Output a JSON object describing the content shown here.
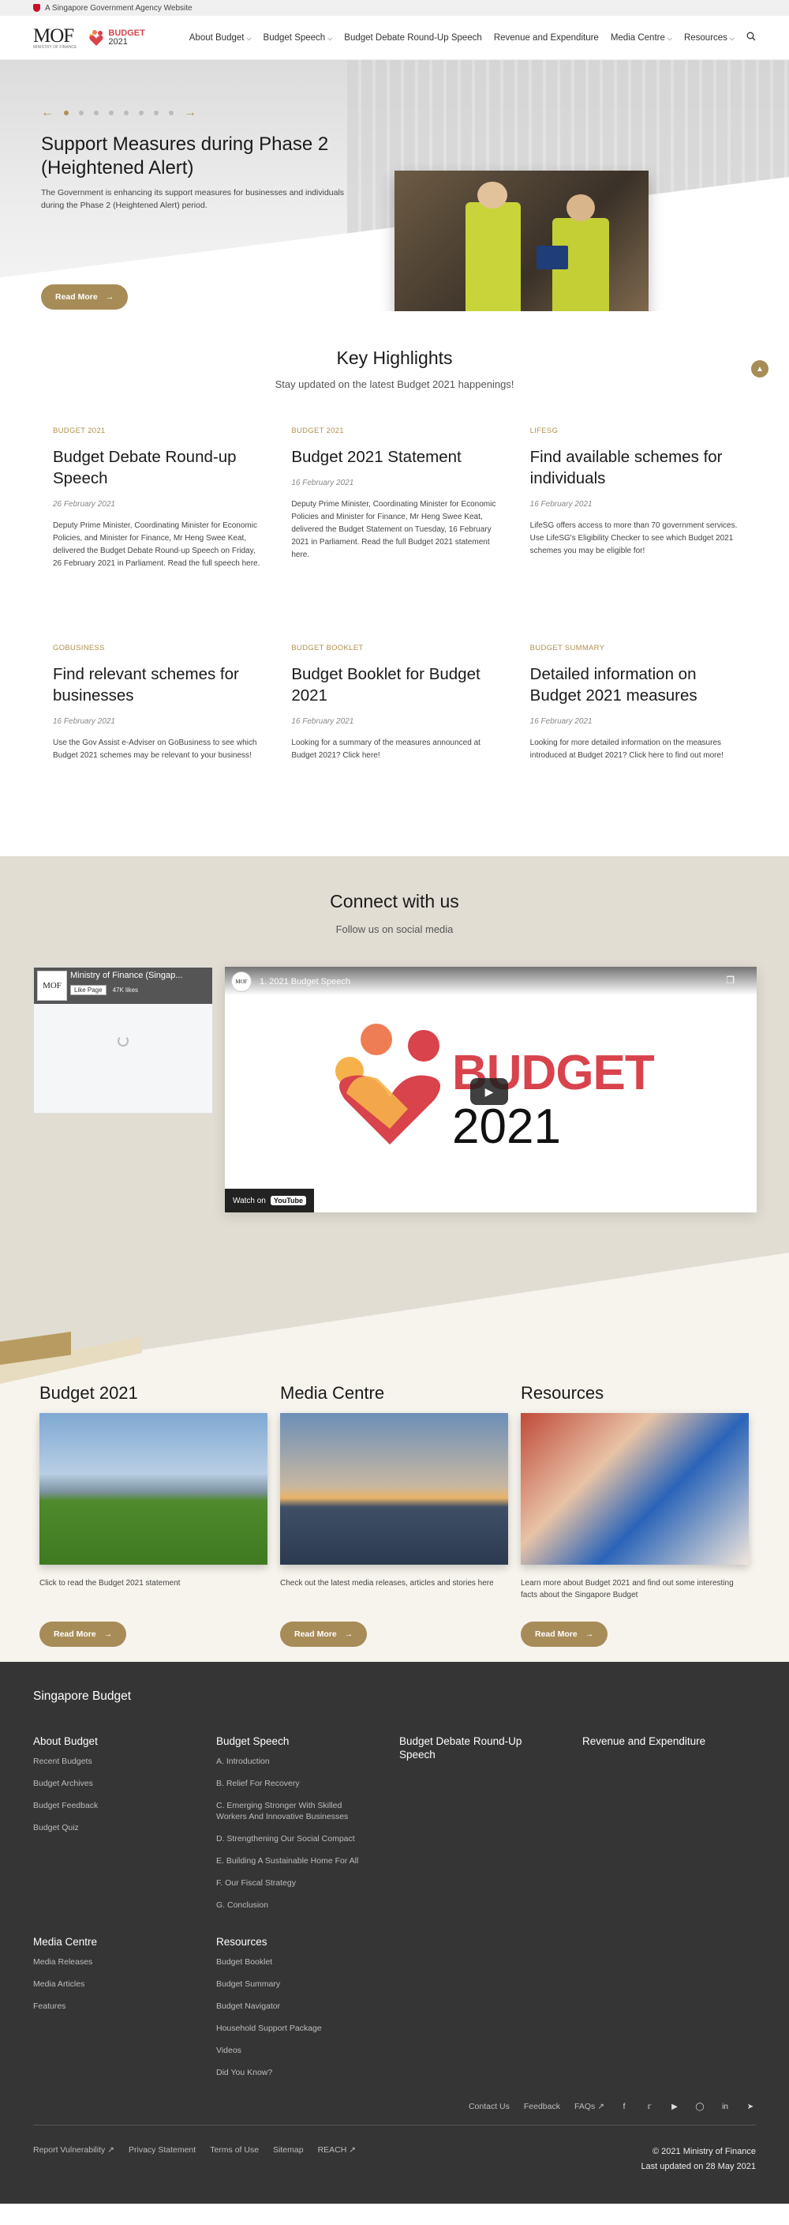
{
  "topbar": {
    "text": "A Singapore Government Agency Website"
  },
  "header": {
    "mof_logo": "MOF",
    "mof_sub": "MINISTRY OF FINANCE",
    "budget_logo_word": "BUDGET",
    "budget_logo_year": "2021",
    "nav": [
      {
        "label": "About Budget",
        "dropdown": true
      },
      {
        "label": "Budget Speech",
        "dropdown": true
      },
      {
        "label": "Budget Debate Round-Up Speech",
        "dropdown": false
      },
      {
        "label": "Revenue and Expenditure",
        "dropdown": false
      },
      {
        "label": "Media Centre",
        "dropdown": true
      },
      {
        "label": "Resources",
        "dropdown": true
      }
    ]
  },
  "hero": {
    "title": "Support Measures during Phase 2 (Heightened Alert)",
    "description": "The Government is enhancing its support measures for businesses and individuals during the Phase 2 (Heightened Alert) period.",
    "button": "Read More",
    "slide_count": 8,
    "active_slide": 1
  },
  "highlights": {
    "title": "Key Highlights",
    "subtitle": "Stay updated on the latest Budget 2021 happenings!",
    "cards": [
      {
        "category": "BUDGET 2021",
        "title": "Budget Debate Round-up Speech",
        "date": "26 February 2021",
        "desc": "Deputy Prime Minister, Coordinating Minister for Economic Policies, and Minister for Finance, Mr Heng Swee Keat, delivered the Budget Debate Round-up Speech on Friday, 26 February 2021 in Parliament. Read the full speech here."
      },
      {
        "category": "BUDGET 2021",
        "title": "Budget 2021 Statement",
        "date": "16 February 2021",
        "desc": "Deputy Prime Minister, Coordinating Minister for Economic Policies and Minister for Finance, Mr Heng Swee Keat, delivered the Budget Statement on Tuesday, 16 February 2021 in Parliament. Read the full Budget 2021 statement here."
      },
      {
        "category": "LIFESG",
        "title": "Find available schemes for individuals",
        "date": "16 February 2021",
        "desc": "LifeSG offers access to more than 70 government services. Use LifeSG's Eligibility Checker to see which Budget 2021 schemes you may be eligible for!"
      },
      {
        "category": "GOBUSINESS",
        "title": "Find relevant schemes for businesses",
        "date": "16 February 2021",
        "desc": "Use the Gov Assist e-Adviser on GoBusiness to see which Budget 2021 schemes may be relevant to your business!"
      },
      {
        "category": "BUDGET BOOKLET",
        "title": "Budget Booklet for Budget 2021",
        "date": "16 February 2021",
        "desc": "Looking for a summary of the measures announced at Budget 2021? Click here!"
      },
      {
        "category": "BUDGET SUMMARY",
        "title": "Detailed information on Budget 2021 measures",
        "date": "16 February 2021",
        "desc": "Looking for more detailed information on the measures introduced at Budget 2021? Click here to find out more!"
      }
    ]
  },
  "connect": {
    "title": "Connect with us",
    "subtitle": "Follow us on social media",
    "facebook": {
      "page_name": "Ministry of Finance (Singap...",
      "like_label": "Like Page",
      "fans": "47K likes",
      "logo": "MOF"
    },
    "video": {
      "title": "1. 2021 Budget Speech",
      "brand_word": "BUDGET",
      "brand_year": "2021",
      "watch_label": "Watch on",
      "yt_label": "YouTube",
      "channel": "MOF"
    }
  },
  "promos": [
    {
      "title": "Budget 2021",
      "text": "Click to read the Budget 2021 statement",
      "button": "Read More"
    },
    {
      "title": "Media Centre",
      "text": "Check out the latest media releases, articles and stories here",
      "button": "Read More"
    },
    {
      "title": "Resources",
      "text": "Learn more about Budget 2021 and find out some interesting facts about the Singapore Budget",
      "button": "Read More"
    }
  ],
  "footer": {
    "title": "Singapore Budget",
    "columns": [
      {
        "heading": "About Budget",
        "links": [
          "Recent Budgets",
          "Budget Archives",
          "Budget Feedback",
          "Budget Quiz"
        ]
      },
      {
        "heading": "Budget Speech",
        "links": [
          "A. Introduction",
          "B. Relief For Recovery",
          "C. Emerging Stronger With Skilled Workers And Innovative Businesses",
          "D. Strengthening Our Social Compact",
          "E. Building A Sustainable Home For All",
          "F. Our Fiscal Strategy",
          "G. Conclusion"
        ]
      },
      {
        "heading": "Budget Debate Round-Up Speech",
        "links": []
      },
      {
        "heading": "Revenue and Expenditure",
        "links": []
      }
    ],
    "columns2": [
      {
        "heading": "Media Centre",
        "links": [
          "Media Releases",
          "Media Articles",
          "Features"
        ]
      },
      {
        "heading": "Resources",
        "links": [
          "Budget Booklet",
          "Budget Summary",
          "Budget Navigator",
          "Household Support Package",
          "Videos",
          "Did You Know?"
        ]
      }
    ],
    "contact_links": [
      "Contact Us",
      "Feedback",
      "FAQs"
    ],
    "legal_links": [
      "Report Vulnerability",
      "Privacy Statement",
      "Terms of Use",
      "Sitemap",
      "REACH"
    ],
    "copyright": "© 2021 Ministry of Finance",
    "updated": "Last updated on 28 May 2021"
  }
}
